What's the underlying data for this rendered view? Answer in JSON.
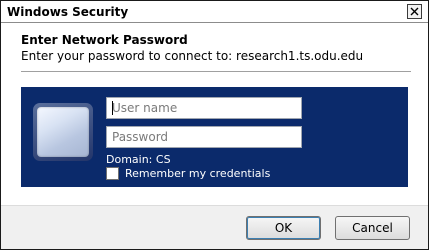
{
  "window": {
    "title": "Windows Security"
  },
  "dialog": {
    "heading": "Enter Network Password",
    "subtext": "Enter your password to connect to: research1.ts.odu.edu"
  },
  "credentials": {
    "username_placeholder": "User name",
    "username_value": "",
    "password_placeholder": "Password",
    "password_value": "",
    "domain_label": "Domain: CS",
    "remember_label": "Remember my credentials",
    "remember_checked": false
  },
  "buttons": {
    "ok_label": "OK",
    "cancel_label": "Cancel"
  },
  "icons": {
    "close": "close-icon",
    "user_tile": "user-tile-icon"
  },
  "colors": {
    "panel": "#0b2a6b",
    "footer": "#f0f0f0"
  }
}
